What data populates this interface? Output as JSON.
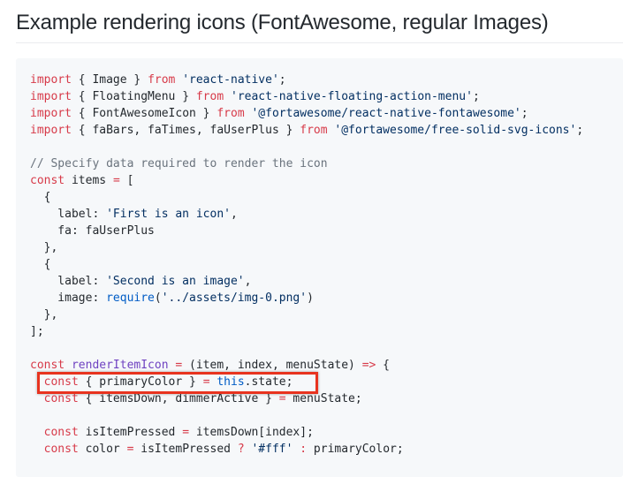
{
  "heading": "Example rendering icons (FontAwesome, regular Images)",
  "colors": {
    "keyword": "#d73a49",
    "string": "#032f62",
    "comment": "#6a737d",
    "function": "#6f42c1",
    "constant": "#005cc5",
    "highlight_border": "#e8331f",
    "code_background": "#f6f8fa"
  },
  "code": {
    "lines": [
      [
        {
          "t": "import",
          "c": "kw"
        },
        {
          "t": " { Image } "
        },
        {
          "t": "from",
          "c": "kw"
        },
        {
          "t": " "
        },
        {
          "t": "'react-native'",
          "c": "str"
        },
        {
          "t": ";"
        }
      ],
      [
        {
          "t": "import",
          "c": "kw"
        },
        {
          "t": " { FloatingMenu } "
        },
        {
          "t": "from",
          "c": "kw"
        },
        {
          "t": " "
        },
        {
          "t": "'react-native-floating-action-menu'",
          "c": "str"
        },
        {
          "t": ";"
        }
      ],
      [
        {
          "t": "import",
          "c": "kw"
        },
        {
          "t": " { FontAwesomeIcon } "
        },
        {
          "t": "from",
          "c": "kw"
        },
        {
          "t": " "
        },
        {
          "t": "'@fortawesome/react-native-fontawesome'",
          "c": "str"
        },
        {
          "t": ";"
        }
      ],
      [
        {
          "t": "import",
          "c": "kw"
        },
        {
          "t": " { faBars, faTimes, faUserPlus } "
        },
        {
          "t": "from",
          "c": "kw"
        },
        {
          "t": " "
        },
        {
          "t": "'@fortawesome/free-solid-svg-icons'",
          "c": "str"
        },
        {
          "t": ";"
        }
      ],
      [],
      [
        {
          "t": "// Specify data required to render the icon",
          "c": "cm"
        }
      ],
      [
        {
          "t": "const",
          "c": "kw"
        },
        {
          "t": " items "
        },
        {
          "t": "=",
          "c": "kw"
        },
        {
          "t": " ["
        }
      ],
      [
        {
          "t": "  {"
        }
      ],
      [
        {
          "t": "    label: "
        },
        {
          "t": "'First is an icon'",
          "c": "str"
        },
        {
          "t": ","
        }
      ],
      [
        {
          "t": "    fa: faUserPlus"
        }
      ],
      [
        {
          "t": "  },"
        }
      ],
      [
        {
          "t": "  {"
        }
      ],
      [
        {
          "t": "    label: "
        },
        {
          "t": "'Second is an image'",
          "c": "str"
        },
        {
          "t": ","
        }
      ],
      [
        {
          "t": "    image: "
        },
        {
          "t": "require",
          "c": "const"
        },
        {
          "t": "("
        },
        {
          "t": "'../assets/img-0.png'",
          "c": "str"
        },
        {
          "t": ")"
        }
      ],
      [
        {
          "t": "  },"
        }
      ],
      [
        {
          "t": "];"
        }
      ],
      [],
      [
        {
          "t": "const",
          "c": "kw"
        },
        {
          "t": " "
        },
        {
          "t": "renderItemIcon",
          "c": "fn"
        },
        {
          "t": " "
        },
        {
          "t": "=",
          "c": "kw"
        },
        {
          "t": " (item, index, menuState) "
        },
        {
          "t": "=>",
          "c": "kw"
        },
        {
          "t": " {"
        }
      ],
      [
        {
          "t": "  "
        },
        {
          "t": "const",
          "c": "kw"
        },
        {
          "t": " { primaryColor } "
        },
        {
          "t": "=",
          "c": "kw"
        },
        {
          "t": " "
        },
        {
          "t": "this",
          "c": "const"
        },
        {
          "t": ".state;"
        }
      ],
      [
        {
          "t": "  "
        },
        {
          "t": "const",
          "c": "kw"
        },
        {
          "t": " { itemsDown, dimmerActive } "
        },
        {
          "t": "=",
          "c": "kw"
        },
        {
          "t": " menuState;"
        }
      ],
      [],
      [
        {
          "t": "  "
        },
        {
          "t": "const",
          "c": "kw"
        },
        {
          "t": " isItemPressed "
        },
        {
          "t": "=",
          "c": "kw"
        },
        {
          "t": " itemsDown[index];"
        }
      ],
      [
        {
          "t": "  "
        },
        {
          "t": "const",
          "c": "kw"
        },
        {
          "t": " color "
        },
        {
          "t": "=",
          "c": "kw"
        },
        {
          "t": " isItemPressed "
        },
        {
          "t": "?",
          "c": "kw"
        },
        {
          "t": " "
        },
        {
          "t": "'#fff'",
          "c": "str"
        },
        {
          "t": " "
        },
        {
          "t": ":",
          "c": "kw"
        },
        {
          "t": " primaryColor;"
        }
      ]
    ],
    "highlighted_line_index": 18
  }
}
